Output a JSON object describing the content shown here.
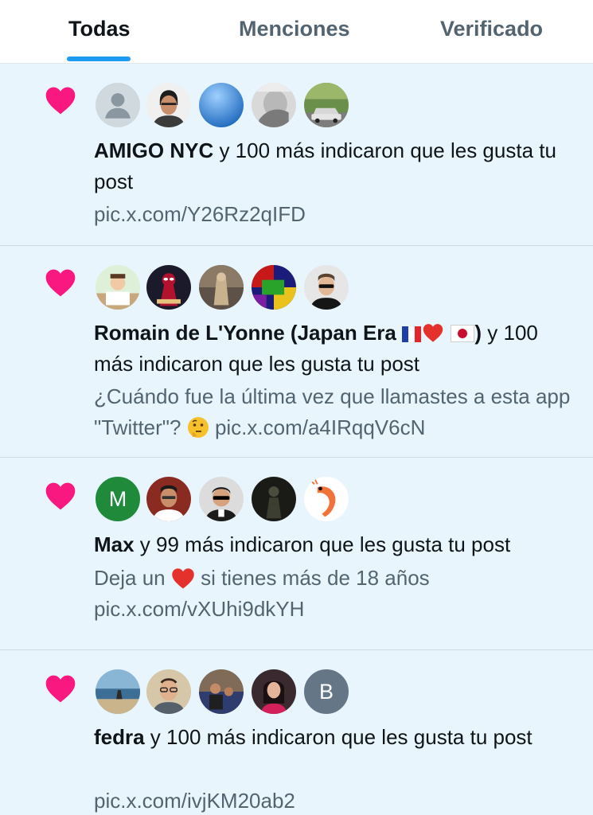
{
  "tabs": [
    {
      "label": "Todas",
      "active": true
    },
    {
      "label": "Menciones",
      "active": false
    },
    {
      "label": "Verificado",
      "active": false
    }
  ],
  "colors": {
    "accent": "#1d9bf0",
    "heart": "#f91880",
    "unread_bg": "#e8f5fd",
    "secondary_text": "#536471"
  },
  "notifications": [
    {
      "user": "AMIGO NYC",
      "action": " y 100 más indicaron que les gusta tu post",
      "preview": "pic.x.com/Y26Rz2qIFD",
      "avatars": [
        "default-avatar",
        "man-photo-avatar",
        "blue-gradient-avatar",
        "photo-avatar",
        "car-photo-avatar"
      ]
    },
    {
      "user": "Romain de L'Yonne (Japan Era",
      "user_close": ")",
      "action": " y 100 más indicaron que les gusta tu post",
      "preview_pre": "¿Cuándo fue la última vez que llamastes a esta app \"Twitter\"? ",
      "preview_post": " pic.x.com/a4IRqqV6cN",
      "emojis": [
        "france-flag-icon",
        "red-heart-icon",
        "japan-flag-icon",
        "thinking-face-icon"
      ],
      "avatars": [
        "cartoon-avatar",
        "spider-avatar",
        "photo-avatar",
        "colorful-avatar",
        "sunglasses-man-avatar"
      ]
    },
    {
      "user": "Max",
      "action": " y 99 más indicaron que les gusta tu post",
      "preview_pre": "Deja un ",
      "preview_post": " si tienes más de 18 años pic.x.com/vXUhi9dkYH",
      "avatars": [
        "letter-avatar",
        "man-photo-avatar",
        "cartoon-sunglasses-avatar",
        "dark-avatar",
        "shrimp-avatar"
      ],
      "letter": "M"
    },
    {
      "user": "fedra",
      "action": " y 100 más indicaron que les gusta tu post",
      "preview": "pic.x.com/ivjKM20ab2",
      "avatars": [
        "beach-photo-avatar",
        "man-glasses-avatar",
        "photo-avatar",
        "woman-photo-avatar",
        "letter-avatar"
      ],
      "letter": "B"
    }
  ]
}
